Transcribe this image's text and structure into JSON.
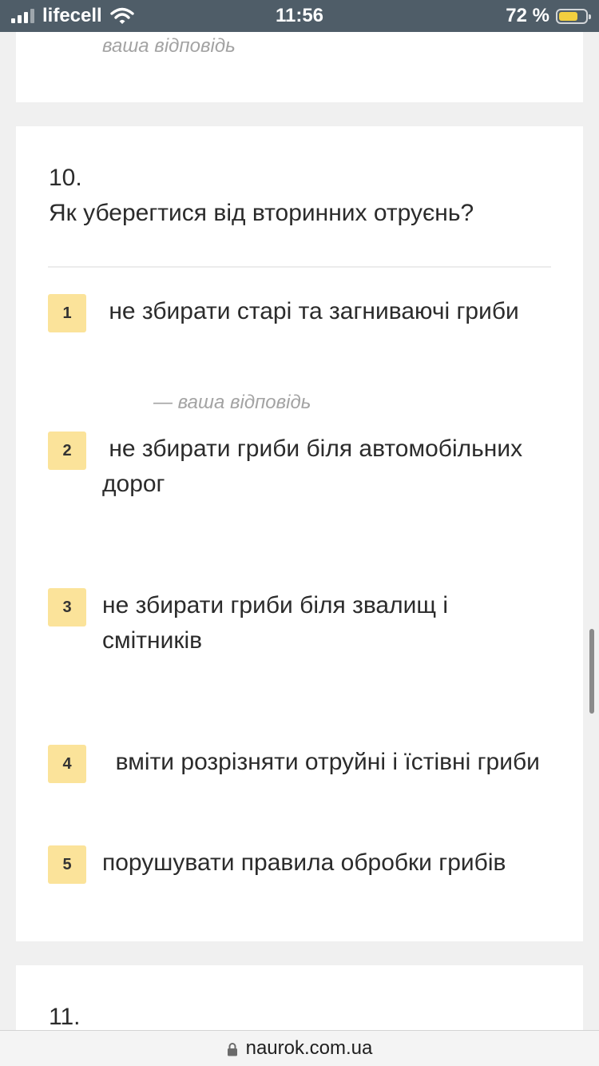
{
  "status_bar": {
    "carrier": "lifecell",
    "time": "11:56",
    "battery_text": "72 %",
    "battery_level_percent": 72,
    "battery_color": "#f2cf3f"
  },
  "previous_card": {
    "your_answer_label": "ваша відповідь"
  },
  "question": {
    "number": "10.",
    "text": "Як уберегтися від вторинних отруєнь?",
    "options": [
      {
        "num": "1",
        "text": " не збирати старі та загниваючі гриби"
      },
      {
        "num": "2",
        "text": " не збирати гриби біля автомобільних дорог"
      },
      {
        "num": "3",
        "text": "не збирати гриби біля звалищ і смітників"
      },
      {
        "num": "4",
        "text": "  вміти розрізняти отруйні і їстівні гриби"
      },
      {
        "num": "5",
        "text": "порушувати правила обробки грибів"
      }
    ],
    "answer_note": "— ваша відповідь",
    "badge_color": "#fbe39a"
  },
  "next_card": {
    "number": "11."
  },
  "url_bar": {
    "domain": "naurok.com.ua",
    "icon": "lock-icon"
  }
}
